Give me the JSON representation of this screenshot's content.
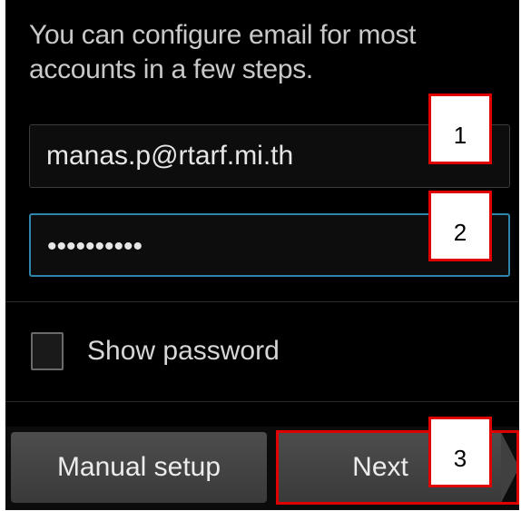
{
  "intro_text": "You can configure email for most accounts in a few steps.",
  "email_field": {
    "value": "manas.p@rtarf.mi.th"
  },
  "password_field": {
    "value": "••••••••••"
  },
  "show_password": {
    "label": "Show password",
    "checked": false
  },
  "buttons": {
    "manual_setup": "Manual setup",
    "next": "Next"
  },
  "callouts": [
    "1",
    "2",
    "3"
  ],
  "colors": {
    "background": "#000000",
    "focus_border": "#2e86ad",
    "annotation_red": "#e00000",
    "button_gray": "#444444"
  }
}
